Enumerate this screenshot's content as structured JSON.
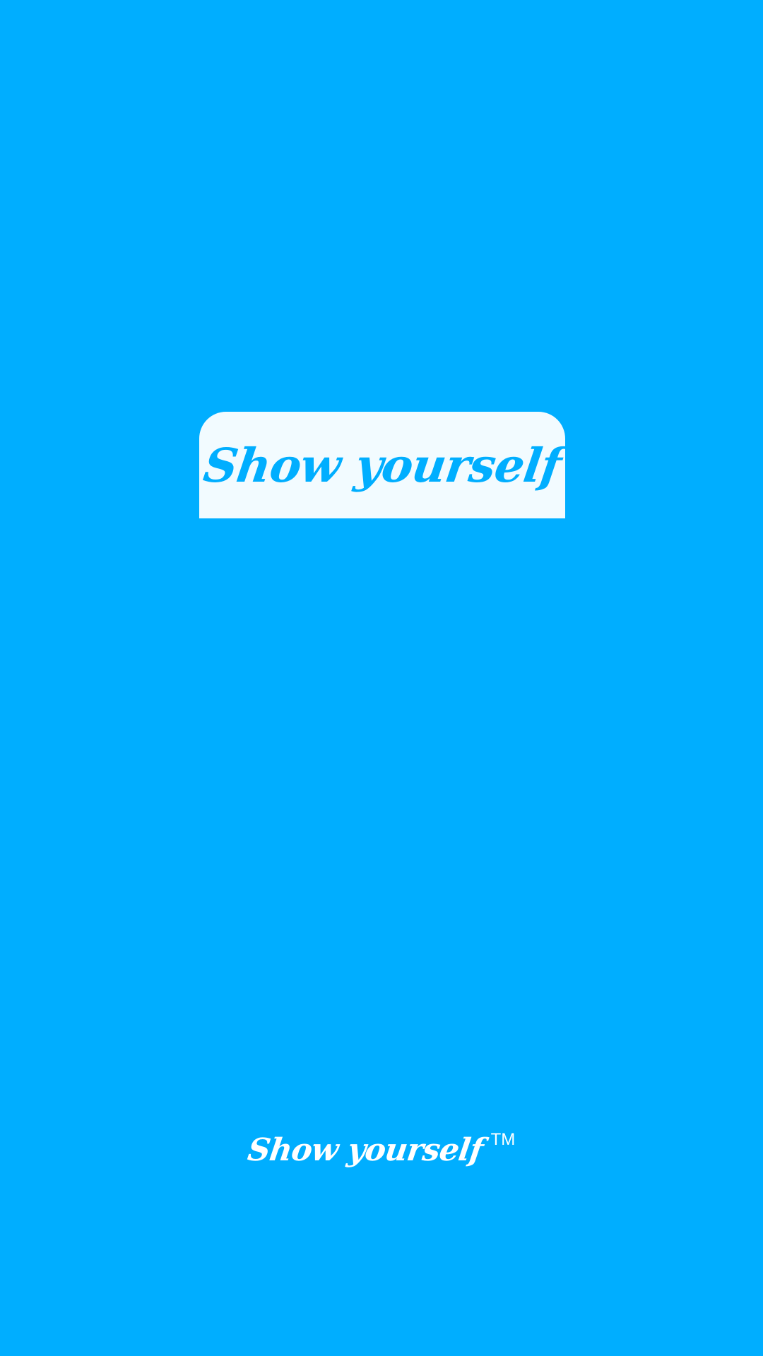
{
  "splash": {
    "logo_text": "Show yourself",
    "footer_brand": "Show yourself",
    "trademark": "TM"
  },
  "colors": {
    "background": "#00aeff",
    "card": "#f2fbff",
    "logo_text": "#00aeff",
    "footer_text": "#ffffff"
  }
}
